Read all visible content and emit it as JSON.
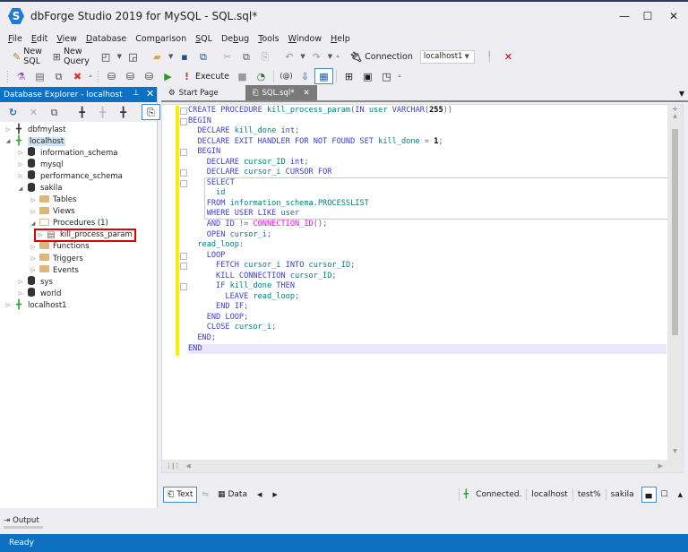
{
  "window": {
    "title": "dbForge Studio 2019 for MySQL - SQL.sql*",
    "logo_letter": "S",
    "controls": {
      "minimize": "—",
      "maximize": "☐",
      "close": "✕"
    }
  },
  "menu": [
    {
      "label": "File",
      "key": "F",
      "rest": "ile"
    },
    {
      "label": "Edit",
      "key": "E",
      "rest": "dit"
    },
    {
      "label": "View",
      "key": "V",
      "rest": "iew"
    },
    {
      "label": "Database",
      "key": "D",
      "rest": "atabase"
    },
    {
      "label": "Comparison",
      "pre": "Com",
      "key": "p",
      "rest": "arison"
    },
    {
      "label": "SQL",
      "key": "S",
      "rest": "QL"
    },
    {
      "label": "Debug",
      "pre": "De",
      "key": "b",
      "rest": "ug"
    },
    {
      "label": "Tools",
      "key": "T",
      "rest": "ools"
    },
    {
      "label": "Window",
      "key": "W",
      "rest": "indow"
    },
    {
      "label": "Help",
      "key": "H",
      "rest": "elp"
    }
  ],
  "toolbar1": {
    "new_sql": "New SQL",
    "new_query": "New Query",
    "connection_label": "Connection",
    "connection_value": "localhost1"
  },
  "toolbar2": {
    "execute": "Execute"
  },
  "db_explorer": {
    "title": "Database Explorer - localhost",
    "pin": "⊥",
    "close": "✕",
    "tree": [
      {
        "label": "dbfmylast",
        "level": 0,
        "icon": "plug",
        "expanded": false
      },
      {
        "label": "localhost",
        "level": 0,
        "icon": "plug-green",
        "expanded": true,
        "selected": true
      },
      {
        "label": "information_schema",
        "level": 1,
        "icon": "db",
        "expanded": false
      },
      {
        "label": "mysql",
        "level": 1,
        "icon": "db",
        "expanded": false
      },
      {
        "label": "performance_schema",
        "level": 1,
        "icon": "db",
        "expanded": false
      },
      {
        "label": "sakila",
        "level": 1,
        "icon": "db",
        "expanded": true
      },
      {
        "label": "Tables",
        "level": 2,
        "icon": "folder",
        "expanded": false
      },
      {
        "label": "Views",
        "level": 2,
        "icon": "folder",
        "expanded": false
      },
      {
        "label": "Procedures (1)",
        "level": 2,
        "icon": "folder-open",
        "expanded": true
      },
      {
        "label": "kill_process_param",
        "level": 3,
        "icon": "proc",
        "expanded": false,
        "highlighted": true
      },
      {
        "label": "Functions",
        "level": 2,
        "icon": "folder",
        "expanded": false
      },
      {
        "label": "Triggers",
        "level": 2,
        "icon": "folder",
        "expanded": false
      },
      {
        "label": "Events",
        "level": 2,
        "icon": "folder",
        "expanded": false
      },
      {
        "label": "sys",
        "level": 1,
        "icon": "db",
        "expanded": false
      },
      {
        "label": "world",
        "level": 1,
        "icon": "db",
        "expanded": false
      },
      {
        "label": "localhost1",
        "level": 0,
        "icon": "plug-green",
        "expanded": false
      }
    ]
  },
  "tabs": [
    {
      "label": "Start Page",
      "active": false
    },
    {
      "label": "SQL.sql*",
      "active": true,
      "close": "✕"
    }
  ],
  "editor": {
    "lines": [
      [
        [
          "kw2",
          "CREATE PROCEDURE "
        ],
        [
          "id",
          "kill_process_param"
        ],
        [
          "p",
          "("
        ],
        [
          "kw2",
          "IN "
        ],
        [
          "id",
          "user "
        ],
        [
          "kw2",
          "VARCHAR"
        ],
        [
          "p",
          "("
        ],
        [
          "num",
          "255"
        ],
        [
          "p",
          "))"
        ]
      ],
      [
        [
          "kw2",
          "BEGIN"
        ]
      ],
      [
        [
          "kw2",
          "  DECLARE "
        ],
        [
          "id",
          "kill_done "
        ],
        [
          "kw2",
          "int"
        ],
        [
          "p",
          ";"
        ]
      ],
      [
        [
          "kw2",
          "  DECLARE EXIT HANDLER FOR NOT FOUND SET "
        ],
        [
          "id",
          "kill_done "
        ],
        [
          "p",
          "= "
        ],
        [
          "num",
          "1"
        ],
        [
          "p",
          ";"
        ]
      ],
      [
        [
          "kw2",
          "  BEGIN"
        ]
      ],
      [
        [
          "kw2",
          "    DECLARE "
        ],
        [
          "id",
          "cursor_ID "
        ],
        [
          "kw2",
          "int"
        ],
        [
          "p",
          ";"
        ]
      ],
      [
        [
          "kw2",
          "    DECLARE "
        ],
        [
          "id",
          "cursor_i "
        ],
        [
          "kw2",
          "CURSOR FOR"
        ]
      ],
      [
        [
          "kw2",
          "    SELECT"
        ]
      ],
      [
        [
          "id",
          "      id"
        ]
      ],
      [
        [
          "kw2",
          "    FROM "
        ],
        [
          "id",
          "information_schema.PROCESSLIST"
        ]
      ],
      [
        [
          "kw2",
          "    WHERE USER LIKE "
        ],
        [
          "id",
          "user"
        ]
      ],
      [
        [
          "kw2",
          "    AND ID "
        ],
        [
          "p",
          "!= "
        ],
        [
          "fn",
          "CONNECTION_ID"
        ],
        [
          "p",
          "();"
        ]
      ],
      [
        [
          "kw2",
          "    OPEN "
        ],
        [
          "id",
          "cursor_i"
        ],
        [
          "p",
          ";"
        ]
      ],
      [
        [
          "id",
          "  read_loop"
        ],
        [
          "p",
          ":"
        ]
      ],
      [
        [
          "kw2",
          "    LOOP"
        ]
      ],
      [
        [
          "kw2",
          "      FETCH "
        ],
        [
          "id",
          "cursor_i "
        ],
        [
          "kw2",
          "INTO "
        ],
        [
          "id",
          "cursor_ID"
        ],
        [
          "p",
          ";"
        ]
      ],
      [
        [
          "kw2",
          "      KILL CONNECTION "
        ],
        [
          "id",
          "cursor_ID"
        ],
        [
          "p",
          ";"
        ]
      ],
      [
        [
          "kw2",
          "      IF "
        ],
        [
          "id",
          "kill_done "
        ],
        [
          "kw2",
          "THEN"
        ]
      ],
      [
        [
          "kw2",
          "        LEAVE "
        ],
        [
          "id",
          "read_loop"
        ],
        [
          "p",
          ";"
        ]
      ],
      [
        [
          "kw2",
          "      END IF"
        ],
        [
          "p",
          ";"
        ]
      ],
      [
        [
          "kw2",
          "    END LOOP"
        ],
        [
          "p",
          ";"
        ]
      ],
      [
        [
          "kw2",
          "    CLOSE "
        ],
        [
          "id",
          "cursor_i"
        ],
        [
          "p",
          ";"
        ]
      ],
      [
        [
          "kw2",
          "  END"
        ],
        [
          "p",
          ";"
        ]
      ],
      [
        [
          "kw2",
          "END"
        ]
      ]
    ],
    "current_line": 23
  },
  "bottom_bar": {
    "text_btn": "Text",
    "data_btn": "Data",
    "status": "Connected.",
    "host": "localhost",
    "user": "test%",
    "database": "sakila"
  },
  "output_tab": "Output",
  "statusbar": {
    "text": "Ready"
  }
}
